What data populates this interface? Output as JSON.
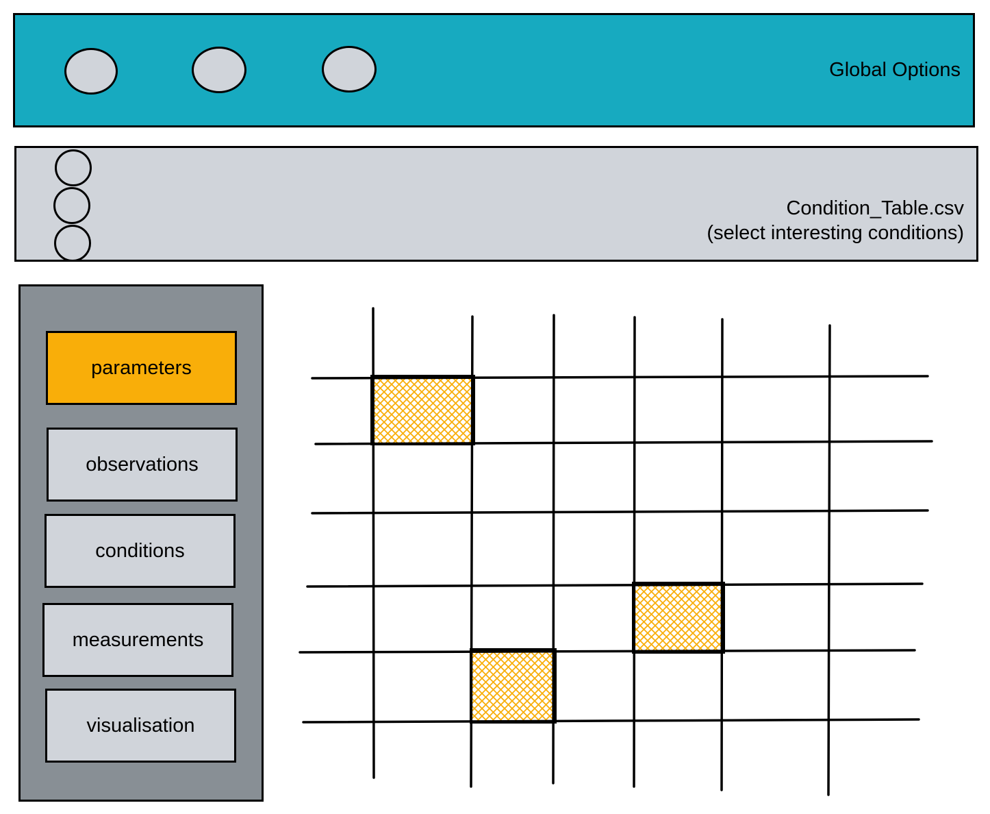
{
  "global_options": {
    "title": "Global Options",
    "bar_color": "#17aac0",
    "option_buttons": [
      "option-1",
      "option-2",
      "option-3"
    ]
  },
  "condition_table": {
    "line1": "Condition_Table.csv",
    "line2": "(select interesting conditions)",
    "radio_options": [
      "condition-option-1",
      "condition-option-2",
      "condition-option-3"
    ]
  },
  "sidebar": {
    "items": [
      {
        "label": "parameters",
        "active": true
      },
      {
        "label": "observations",
        "active": false
      },
      {
        "label": "conditions",
        "active": false
      },
      {
        "label": "measurements",
        "active": false
      },
      {
        "label": "visualisation",
        "active": false
      }
    ]
  },
  "grid": {
    "columns": 6,
    "rows": 5,
    "highlight_color": "#f9ae09",
    "highlighted_cells": [
      {
        "row": 0,
        "col": 0
      },
      {
        "row": 3,
        "col": 3
      },
      {
        "row": 4,
        "col": 1
      }
    ]
  }
}
